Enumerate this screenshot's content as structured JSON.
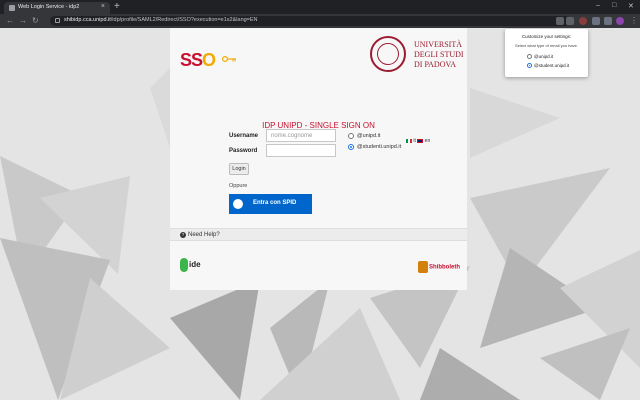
{
  "browser": {
    "tab_title": "Web Login Service - idp2",
    "tab_close": "×",
    "new_tab": "+",
    "url_host": "shibidp.cca.unipd.it",
    "url_path": "/idp/profile/SAML2/Redirect/SSO?execution=e1s2&lang=EN",
    "window_controls": [
      "–",
      "□",
      "✕"
    ]
  },
  "page": {
    "sso_logo_text": [
      "SS",
      "O"
    ],
    "university_name": [
      "UNIVERSITÀ",
      "DEGLI STUDI",
      "DI PADOVA"
    ],
    "title": "IDP UNIPD - SINGLE SIGN ON",
    "lang_it": "it",
    "lang_en": "en",
    "username_label": "Username",
    "username_placeholder": "nome.cognome",
    "password_label": "Password",
    "domain_option_1": "@unipd.it",
    "domain_option_2": "@studenti.unipd.it",
    "domain_selected": "@studenti.unipd.it",
    "login_button": "Login",
    "oppure": "Oppure",
    "spid_button": "Entra con SPID",
    "help_text": "Need Help?",
    "ide_logo_text": "ide",
    "shibboleth_text": "Shibboleth"
  },
  "extension_popup": {
    "title": "Customize your settings:",
    "subtitle": "Select what type of email you have.",
    "option_1": "@unipd.it",
    "option_2": "@student.unipd.it",
    "selected": "@student.unipd.it"
  },
  "colors": {
    "brand_red": "#c8102e",
    "unipd_red": "#9b1b30",
    "spid_blue": "#0066cc"
  }
}
